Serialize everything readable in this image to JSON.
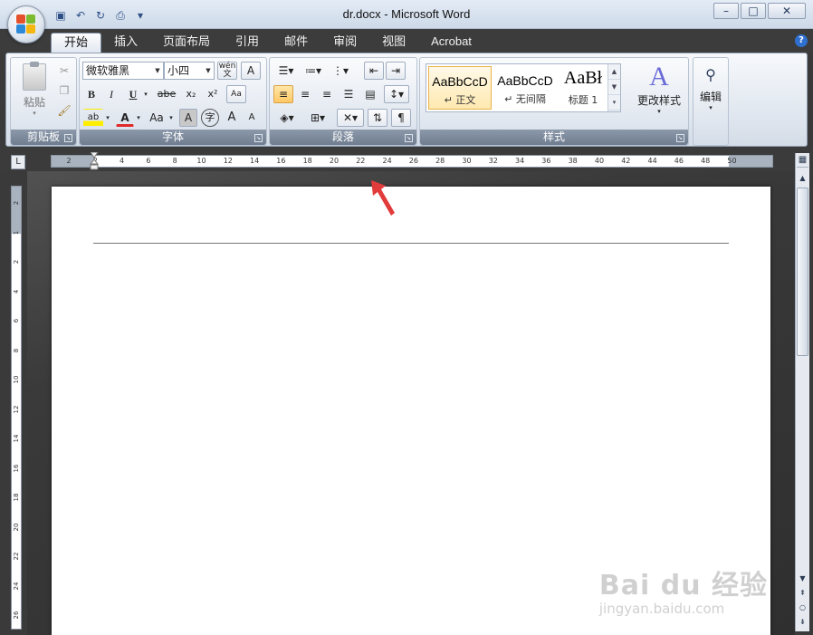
{
  "titlebar": {
    "title": "dr.docx - Microsoft Word",
    "qat_icons": [
      "save-icon",
      "undo-icon",
      "redo-icon",
      "print-preview-icon",
      "customize-qat-icon"
    ]
  },
  "tabs": [
    "开始",
    "插入",
    "页面布局",
    "引用",
    "邮件",
    "审阅",
    "视图",
    "Acrobat"
  ],
  "active_tab": "开始",
  "ribbon": {
    "clipboard": {
      "paste_label": "粘贴",
      "group_label": "剪贴板"
    },
    "font": {
      "font_name": "微软雅黑",
      "font_size": "小四",
      "phonetic": "wén",
      "border_char": "A",
      "bold": "B",
      "italic": "I",
      "underline": "U",
      "strike": "abe",
      "subscript": "x₂",
      "superscript": "x²",
      "clear": "Aa",
      "highlight": "ab",
      "font_color": "A",
      "change_case": "Aa",
      "shade_char": "A",
      "enclose_char": "字",
      "grow": "A",
      "shrink": "A",
      "group_label": "字体"
    },
    "paragraph": {
      "group_label": "段落"
    },
    "styles": {
      "group_label": "样式",
      "cards": [
        {
          "sample": "AaBbCcD",
          "name": "↵ 正文"
        },
        {
          "sample": "AaBbCcD",
          "name": "↵ 无间隔"
        },
        {
          "sample": "AaBł",
          "name": "标题 1"
        }
      ],
      "change_styles": "更改样式"
    },
    "editing": {
      "label": "编辑"
    }
  },
  "ruler": {
    "ticks": [
      "2",
      "2",
      "4",
      "6",
      "8",
      "10",
      "12",
      "14",
      "16",
      "18",
      "20",
      "22",
      "24",
      "26",
      "28",
      "30",
      "32",
      "34",
      "36",
      "38",
      "40",
      "42",
      "44",
      "46",
      "48",
      "50"
    ],
    "vticks": [
      "2",
      "1",
      "2",
      "4",
      "6",
      "8",
      "10",
      "12",
      "14",
      "16",
      "18",
      "20",
      "22",
      "24",
      "26"
    ]
  },
  "watermark": {
    "main": "Bai du 经验",
    "sub": "jingyan.baidu.com"
  },
  "colors": {
    "accent_red": "#e23b3b",
    "tab_bar": "#3c3c3c"
  }
}
